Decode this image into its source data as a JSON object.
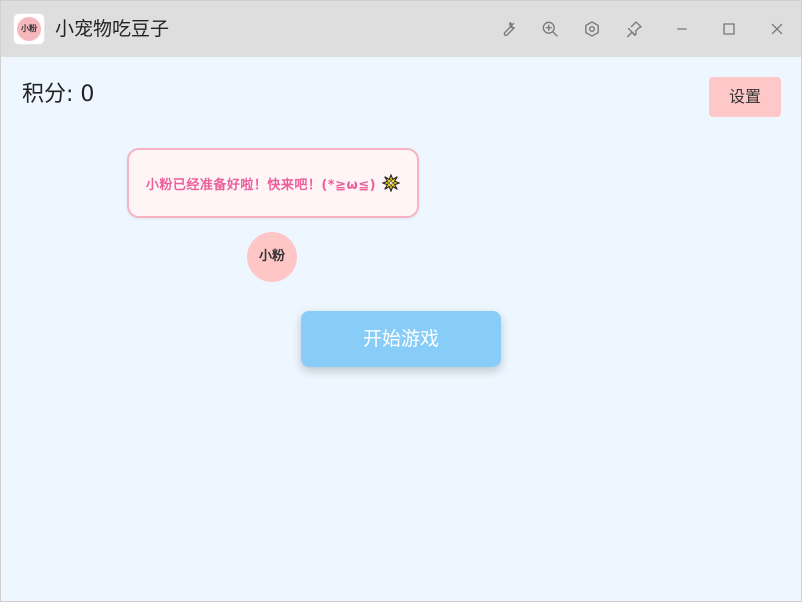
{
  "window": {
    "title": "小宠物吃豆子",
    "app_icon_label": "小粉"
  },
  "titlebar_buttons": {
    "tools_icon": "wrench-icon",
    "zoom_icon": "zoom-in-icon",
    "settings_icon": "hexagon-gear-icon",
    "pin_icon": "pin-icon",
    "minimize_icon": "minimize-icon",
    "maximize_icon": "maximize-icon",
    "close_icon": "close-icon"
  },
  "game": {
    "score_label": "积分: ",
    "score_value": "0",
    "settings_button": "设置",
    "speech_bubble": "小粉已经准备好啦！快来吧！(*≧ω≦)",
    "burst_icon": "burst-icon",
    "pet_name": "小粉",
    "start_button": "开始游戏"
  },
  "colors": {
    "background": "#eef6ff",
    "titlebar": "#dedede",
    "settings_button": "#ffc8c8",
    "pet": "#ffc6c8",
    "start_button": "#87cdf8",
    "bubble_text": "#ec5f9b",
    "bubble_border": "#f7b3c4"
  }
}
